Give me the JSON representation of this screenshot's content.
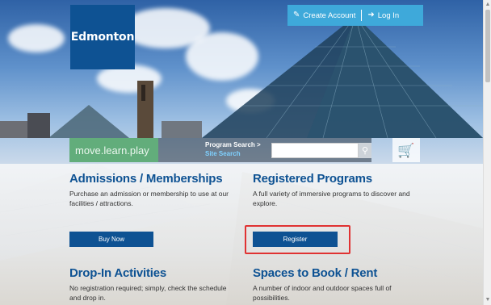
{
  "brand": {
    "logo_text": "Edmonton",
    "tagline": "move.learn.play"
  },
  "account": {
    "create_label": "Create Account",
    "login_label": "Log In"
  },
  "search": {
    "program_search_label": "Program Search >",
    "site_search_label": "Site Search",
    "placeholder": ""
  },
  "cards": [
    {
      "title": "Admissions / Memberships",
      "desc": "Purchase an admission or membership to use at our facilities / attractions.",
      "button": "Buy Now"
    },
    {
      "title": "Registered Programs",
      "desc": "A full variety of immersive programs to discover and explore.",
      "button": "Register"
    },
    {
      "title": "Drop-In Activities",
      "desc": "No registration required; simply, check the schedule and drop in."
    },
    {
      "title": "Spaces to Book / Rent",
      "desc": "A number of indoor and outdoor spaces full of possibilities."
    }
  ],
  "icons": {
    "create": "edit-icon",
    "login": "login-icon",
    "search": "search-icon",
    "cart": "cart-icon"
  },
  "colors": {
    "brand_blue": "#0e5293",
    "account_bar": "#3ea9da",
    "tagline_green": "#62ad7b",
    "highlight_red": "#e03232"
  }
}
